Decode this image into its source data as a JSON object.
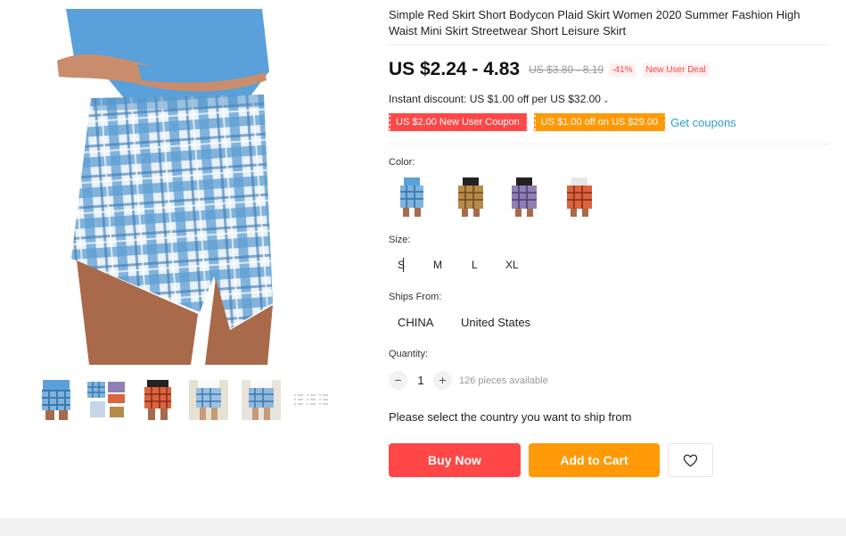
{
  "product": {
    "title": "Simple Red Skirt Short Bodycon Plaid Skirt Women 2020 Summer Fashion High Waist Mini Skirt Streetwear Short Leisure Skirt"
  },
  "price": {
    "current": "US $2.24 - 4.83",
    "original": "US $3.80 - 8.19",
    "discount": "-41%",
    "deal_tag": "New User Deal"
  },
  "instant_discount": "Instant discount: US $1.00 off per US $32.00",
  "coupons": {
    "items": [
      {
        "label": "US $2.00 New User Coupon",
        "color": "#ff4747"
      },
      {
        "label": "US $1.00 off on US $29.00",
        "color": "#ff9908"
      }
    ],
    "get_label": "Get coupons"
  },
  "color": {
    "label": "Color:",
    "swatches": [
      {
        "name": "blue-plaid",
        "color": "#6aa6d6"
      },
      {
        "name": "khaki-plaid",
        "color": "#b78a4a"
      },
      {
        "name": "purple-plaid",
        "color": "#8f7fb2"
      },
      {
        "name": "red-plaid",
        "color": "#d9643e"
      }
    ]
  },
  "size": {
    "label": "Size:",
    "options": [
      "S",
      "M",
      "L",
      "XL"
    ]
  },
  "ships_from": {
    "label": "Ships From:",
    "options": [
      "CHINA",
      "United States"
    ]
  },
  "quantity": {
    "label": "Quantity:",
    "value": "1",
    "available": "126 pieces available",
    "minus": "−",
    "plus": "+"
  },
  "ship_notice": "Please select the country you want to ship from",
  "actions": {
    "buy_now": "Buy Now",
    "add_to_cart": "Add to Cart",
    "wishlist_icon": "heart-icon"
  },
  "colors": {
    "accent_red": "#ff4747",
    "accent_orange": "#ff9908",
    "link_blue": "#2e9cc3"
  }
}
